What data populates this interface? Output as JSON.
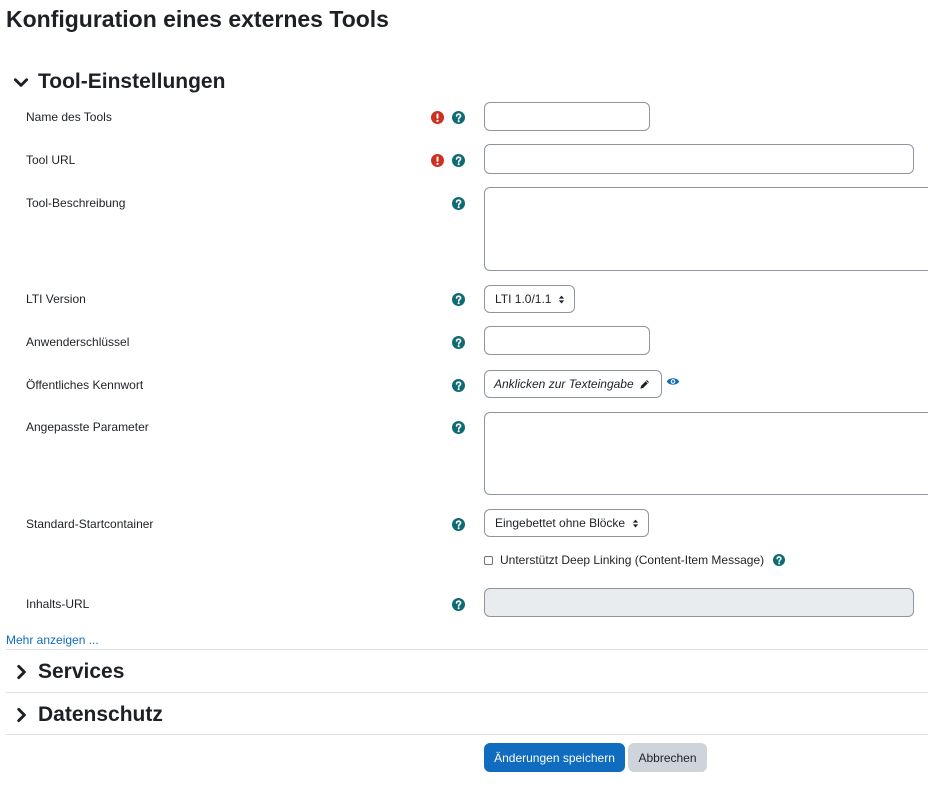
{
  "page": {
    "title": "Konfiguration eines externes Tools"
  },
  "sections": {
    "tool_settings": "Tool-Einstellungen",
    "services": "Services",
    "privacy": "Datenschutz"
  },
  "fields": {
    "tool_name": {
      "label": "Name des Tools",
      "value": ""
    },
    "tool_url": {
      "label": "Tool URL",
      "value": ""
    },
    "tool_description": {
      "label": "Tool-Beschreibung",
      "value": ""
    },
    "lti_version": {
      "label": "LTI Version",
      "selected": "LTI 1.0/1.1"
    },
    "consumer_key": {
      "label": "Anwenderschlüssel",
      "value": ""
    },
    "shared_secret": {
      "label": "Öffentliches Kennwort",
      "placeholder": "Anklicken zur Texteingabe"
    },
    "custom_params": {
      "label": "Angepasste Parameter",
      "value": ""
    },
    "launch_container": {
      "label": "Standard-Startcontainer",
      "selected": "Eingebettet ohne Blöcke"
    },
    "deep_linking": {
      "label": "Unterstützt Deep Linking (Content-Item Message)",
      "checked": false
    },
    "content_url": {
      "label": "Inhalts-URL",
      "value": ""
    }
  },
  "links": {
    "show_more": "Mehr anzeigen ..."
  },
  "buttons": {
    "save": "Änderungen speichern",
    "cancel": "Abbrechen"
  },
  "colors": {
    "required": "#ca3120",
    "help": "#0f6b73",
    "primary": "#0f6cbf",
    "secondary": "#ced4da"
  },
  "icons": {
    "required": "exclamation-circle-icon",
    "help": "question-circle-icon",
    "reveal": "eye-icon",
    "edit": "pencil-icon",
    "expanded": "chevron-down-icon",
    "collapsed": "chevron-right-icon"
  }
}
